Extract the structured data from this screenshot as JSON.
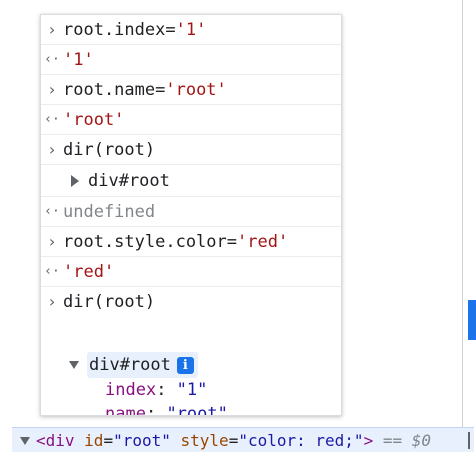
{
  "console": {
    "entries": [
      {
        "type": "input",
        "code": "root.index=",
        "value": "'1'"
      },
      {
        "type": "output",
        "value": "'1'"
      },
      {
        "type": "input",
        "code": "root.name=",
        "value": "'root'"
      },
      {
        "type": "output",
        "value": "'root'"
      },
      {
        "type": "input",
        "code": "dir(root)"
      },
      {
        "type": "object",
        "label": "div#root"
      },
      {
        "type": "output-undefined",
        "value": "undefined"
      },
      {
        "type": "input",
        "code": "root.style.color=",
        "value": "'red'"
      },
      {
        "type": "output",
        "value": "'red'"
      },
      {
        "type": "input",
        "code": "dir(root)"
      }
    ],
    "expanded": {
      "label": "div#root",
      "info_icon": "i",
      "props": [
        {
          "key": "index",
          "value": "\"1\""
        },
        {
          "key": "name",
          "value": "\"root\""
        }
      ],
      "cut_text": "… ' ( . . : ' . . …"
    }
  },
  "element_bar": {
    "open": "<div",
    "attr1_name": "id",
    "attr1_value": "\"root\"",
    "attr2_name": "style",
    "attr2_value": "\"color: red;\"",
    "close": ">",
    "selected_marker": "== $0"
  },
  "glyphs": {
    "prompt": "›",
    "result": "‹·"
  },
  "colors": {
    "string": "#a31515",
    "key": "#881280",
    "value": "#1a1aa6",
    "highlight": "#e8f0fe",
    "info": "#1a73e8"
  }
}
